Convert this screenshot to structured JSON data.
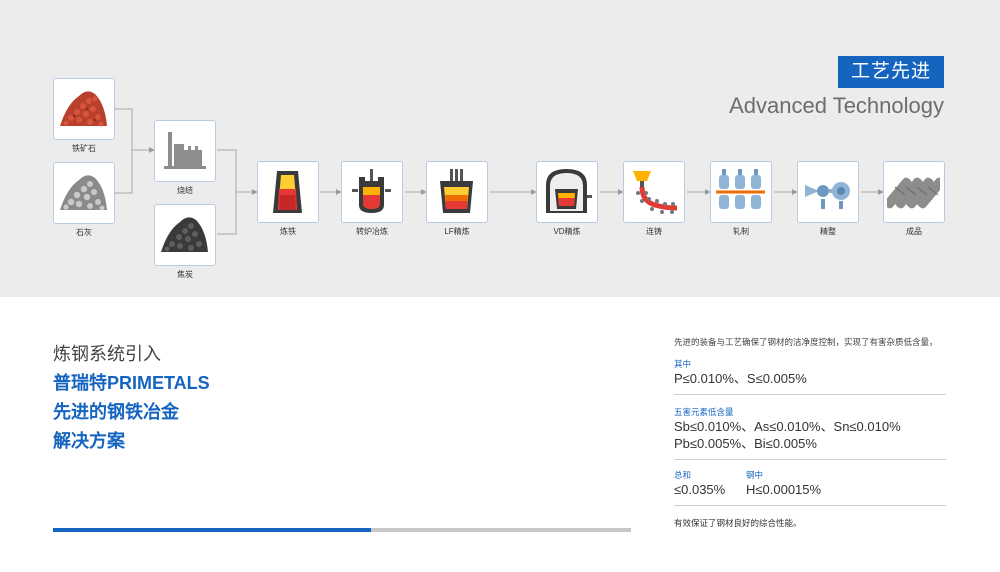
{
  "header": {
    "badge_cn": "工艺先进",
    "title_en": "Advanced Technology"
  },
  "process": {
    "raw_materials": [
      {
        "label": "铁矿石",
        "icon": "iron-ore-icon"
      },
      {
        "label": "石灰",
        "icon": "limestone-icon"
      },
      {
        "label": "焦炭",
        "icon": "coke-icon"
      }
    ],
    "sinter": {
      "label": "烧结",
      "icon": "sinter-plant-icon"
    },
    "steps": [
      {
        "label": "炼铁",
        "icon": "blast-furnace-icon"
      },
      {
        "label": "转炉冶炼",
        "icon": "converter-icon"
      },
      {
        "label": "LF精炼",
        "icon": "ladle-furnace-icon"
      },
      {
        "label": "VD精炼",
        "icon": "vacuum-degassing-icon"
      },
      {
        "label": "连铸",
        "icon": "continuous-casting-icon"
      },
      {
        "label": "轧制",
        "icon": "rolling-mill-icon"
      },
      {
        "label": "精整",
        "icon": "finishing-icon"
      },
      {
        "label": "成品",
        "icon": "finished-product-icon"
      }
    ]
  },
  "left": {
    "line1": "炼钢系统引入",
    "line2": "普瑞特PRIMETALS",
    "line3": "先进的钢铁冶金",
    "line4": "解决方案",
    "progress_fraction": 0.55
  },
  "panel": {
    "intro": "先进的装备与工艺确保了钢材的洁净度控制，实现了有害杂质低含量，",
    "sec1_label": "其中",
    "sec1_value": "P≤0.010%、S≤0.005%",
    "sec2_label": "五害元素低含量",
    "sec2_value1": "Sb≤0.010%、As≤0.010%、Sn≤0.010%",
    "sec2_value2": "Pb≤0.005%、Bi≤0.005%",
    "sec3a_label": "总和",
    "sec3a_value": "≤0.035%",
    "sec3b_label": "钢中",
    "sec3b_value": "H≤0.00015%",
    "outro": "有效保证了钢材良好的综合性能。"
  },
  "colors": {
    "accent": "#1565c0",
    "box_border": "#b9cbe3",
    "top_bg": "#ececec",
    "molten": "#f57c00"
  }
}
